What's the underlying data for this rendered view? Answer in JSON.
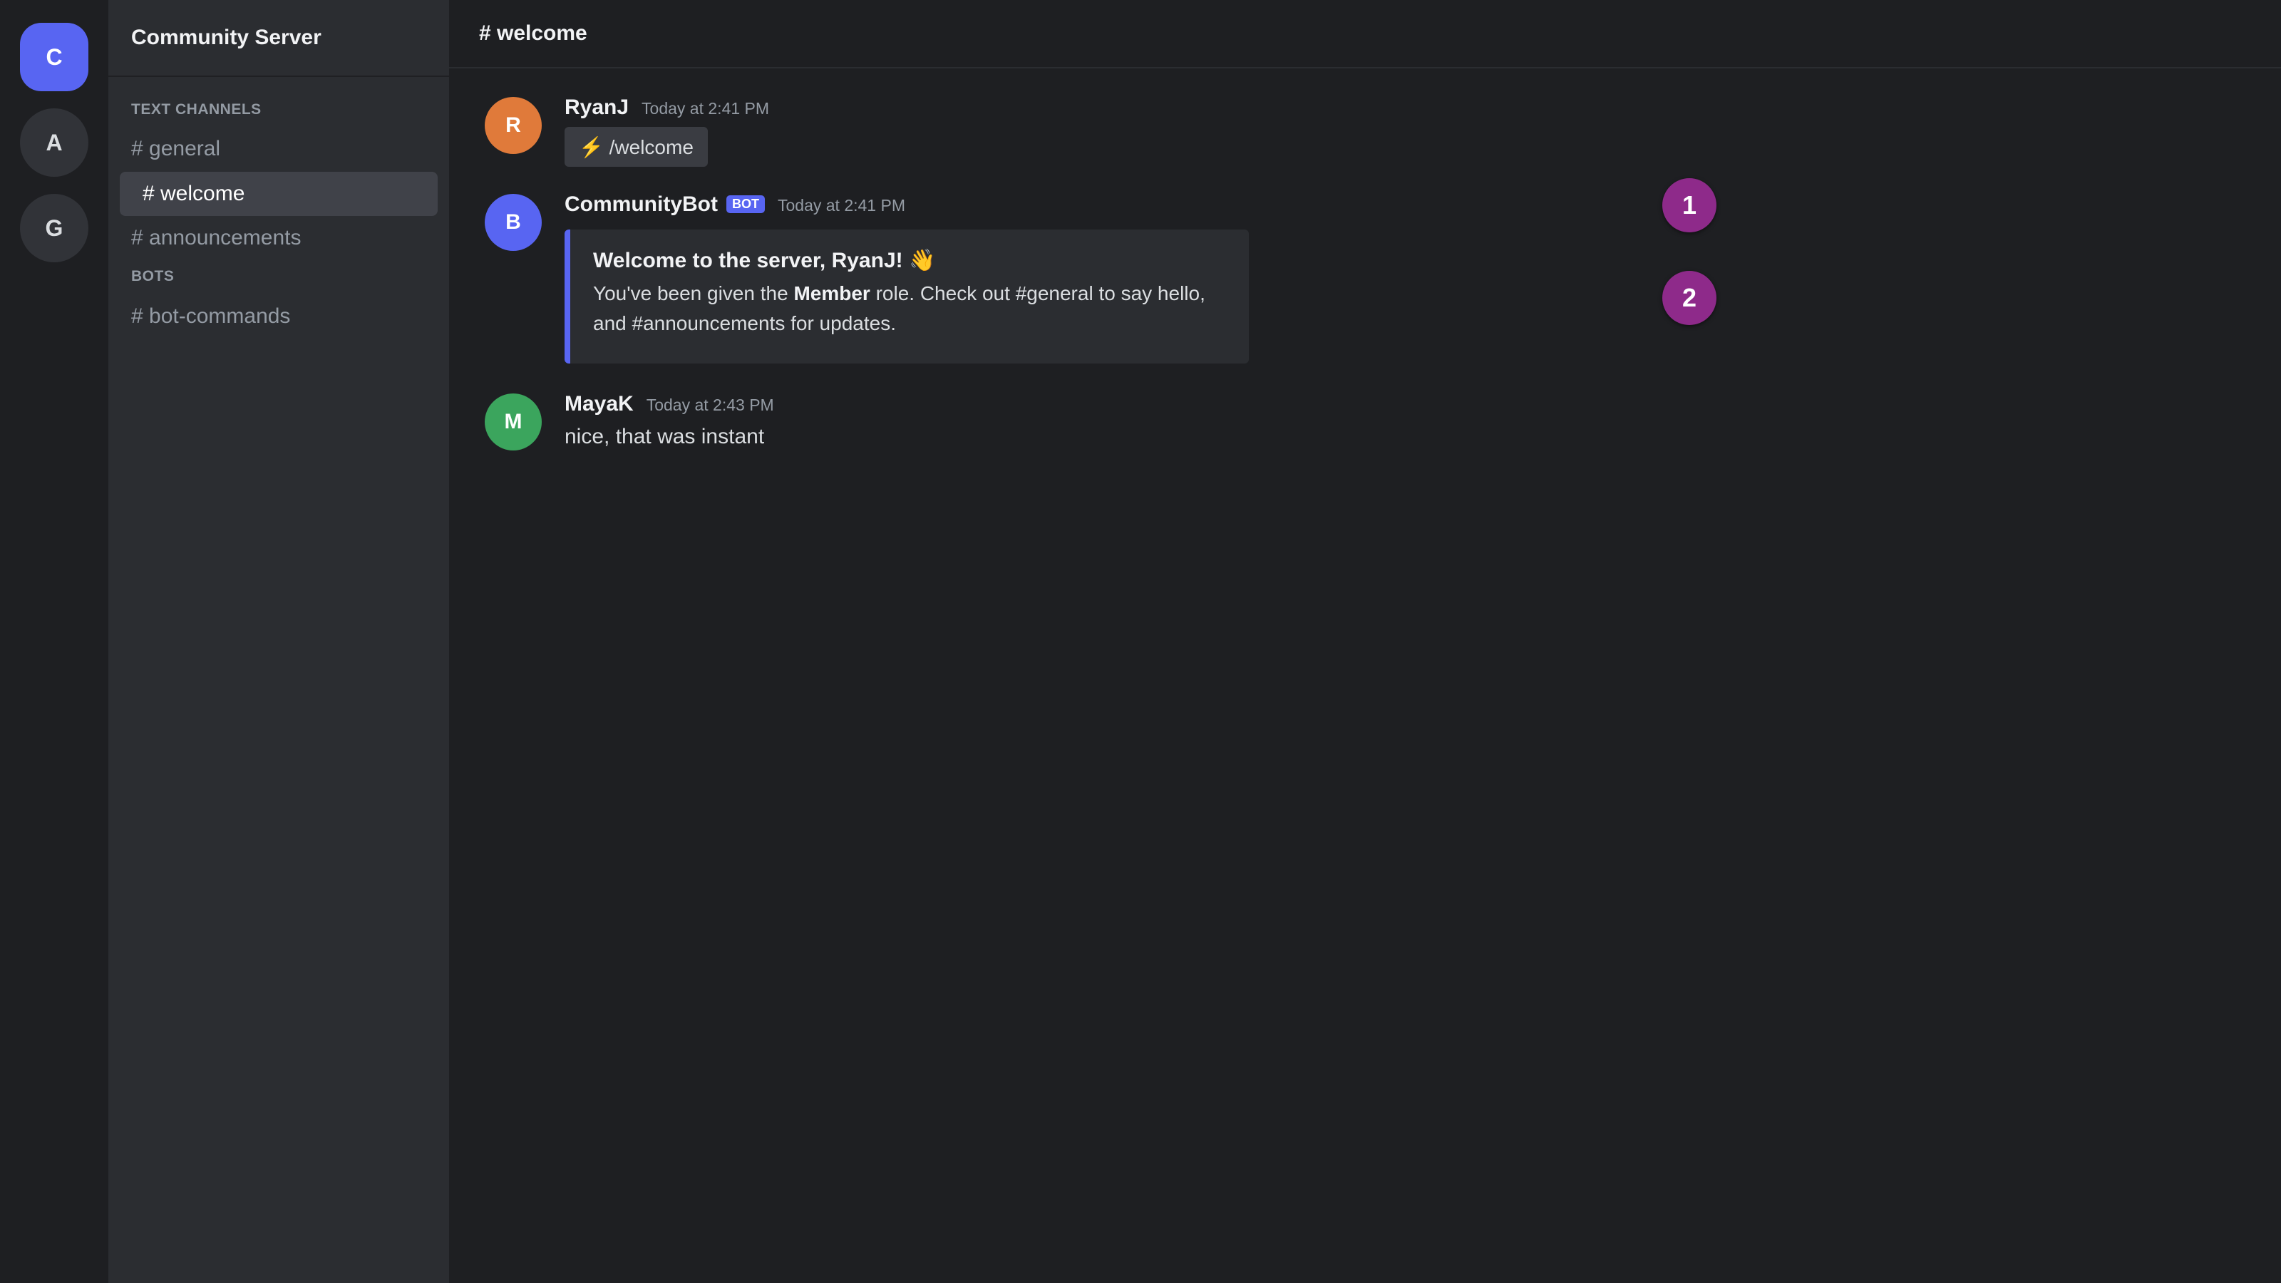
{
  "colors": {
    "accent": "#5865f2",
    "avatar_ryan": "#e07a3a",
    "avatar_bot": "#5865f2",
    "avatar_maya": "#3ba55d",
    "marker": "#8e2a8a"
  },
  "servers": [
    {
      "letter": "C",
      "active": true
    },
    {
      "letter": "A",
      "active": false
    },
    {
      "letter": "G",
      "active": false
    }
  ],
  "sidebar": {
    "server_name": "Community Server",
    "categories": [
      {
        "label": "TEXT CHANNELS"
      },
      {
        "label": "BOTS"
      }
    ],
    "channels": [
      {
        "label": "# general"
      },
      {
        "label": "# welcome",
        "active": true
      },
      {
        "label": "# announcements"
      },
      {
        "label": "# bot-commands"
      }
    ]
  },
  "main": {
    "channel_title": "# welcome",
    "messages": [
      {
        "initial": "R",
        "author": "RyanJ",
        "time": "Today at 2:41 PM",
        "command": "⚡ /welcome"
      },
      {
        "initial": "B",
        "author": "CommunityBot",
        "badge": "BOT",
        "time": "Today at 2:41 PM",
        "embed": {
          "title": "Welcome to the server, RyanJ! 👋",
          "desc_before": "You've been given the ",
          "desc_bold": "Member",
          "desc_after": " role. Check out #general to say hello, and #announcements for updates."
        }
      },
      {
        "initial": "M",
        "author": "MayaK",
        "time": "Today at 2:43 PM",
        "text": "nice, that was instant"
      }
    ]
  },
  "markers": [
    "1",
    "2"
  ]
}
